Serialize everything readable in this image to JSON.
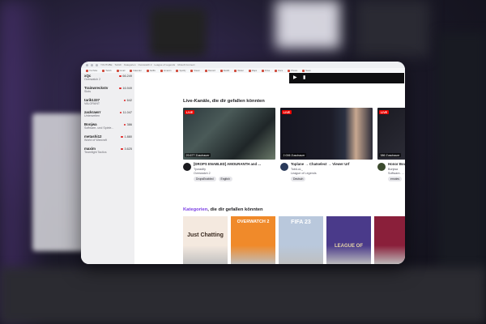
{
  "browser": {
    "tabs": [
      "YOUTUBE",
      "Twitch",
      "Kategorien",
      "Overwatch 2",
      "League of Legends",
      "Ubisoft Connect"
    ],
    "bookmarks": [
      "YouTube",
      "Twitch",
      "Gmail",
      "Kalender",
      "Netflix",
      "Amazon",
      "Spotify",
      "Steam",
      "Discord",
      "Reddit",
      "Wetter",
      "Maps",
      "Drive",
      "Docs",
      "Photos",
      "News"
    ]
  },
  "sidebar": {
    "channels": [
      {
        "name": "xQc",
        "game": "Overwatch 2",
        "viewers": "66.249"
      },
      {
        "name": "Trainwreckstv",
        "game": "Slots",
        "viewers": "16.949"
      },
      {
        "name": "tarik1337",
        "game": "VALORANT",
        "viewers": "642"
      },
      {
        "name": "zackrawrr",
        "game": "Unterwelten",
        "viewers": "11.047"
      },
      {
        "name": "Bonjwa",
        "game": "Software- und Spiele...",
        "viewers": "386"
      },
      {
        "name": "metashi12",
        "game": "World of Warcraft",
        "viewers": "1.880"
      },
      {
        "name": "maxim",
        "game": "Teamfight Tactics",
        "viewers": "3.625"
      }
    ]
  },
  "player": {
    "play_icon": "▶",
    "mute_icon": "▮"
  },
  "live_section": {
    "title": "Live-Kanäle, die dir gefallen könnten",
    "cards": [
      {
        "live": "LIVE",
        "viewers": "29.677 Zuschauer",
        "title": "[DROPS ENABLED] AMOURANTH and ...",
        "channel": "Tyoradify",
        "game": "Overwatch 2",
        "tags": [
          "DropsEnabled",
          "English"
        ],
        "avatar_color": "#1b1b1f"
      },
      {
        "live": "LIVE",
        "viewers": "2.006 Zuschauer",
        "title": "Toplane → Chatselect → Viewer Urf",
        "channel": "TobiLoL_",
        "game": "League of Legends",
        "tags": [
          "Deutsch"
        ],
        "avatar_color": "#2a3a5a"
      },
      {
        "live": "LIVE",
        "viewers": "386 Zuschauer",
        "title": "Honor Bound ...",
        "channel": "Bonjwa",
        "game": "Software- ...",
        "tags": [
          "emotes"
        ],
        "avatar_color": "#3b4a2e"
      }
    ]
  },
  "categories_section": {
    "title_accent": "Kategorien",
    "title_rest": ", die dir gefallen könnten",
    "items": [
      {
        "label": "Just Chatting",
        "bg": "#f4e9df",
        "fg": "#3a2a20"
      },
      {
        "label": "OVERWATCH 2",
        "bg": "#f08a2a",
        "fg": "#ffffff"
      },
      {
        "label": "FIFA 23",
        "bg": "#b9c8dc",
        "fg": "#ffffff"
      },
      {
        "label": "LEAGUE OF",
        "bg": "#4a3a8a",
        "fg": "#e8d7a8"
      },
      {
        "label": "",
        "bg": "#8a1f3a",
        "fg": "#ffffff"
      }
    ]
  }
}
